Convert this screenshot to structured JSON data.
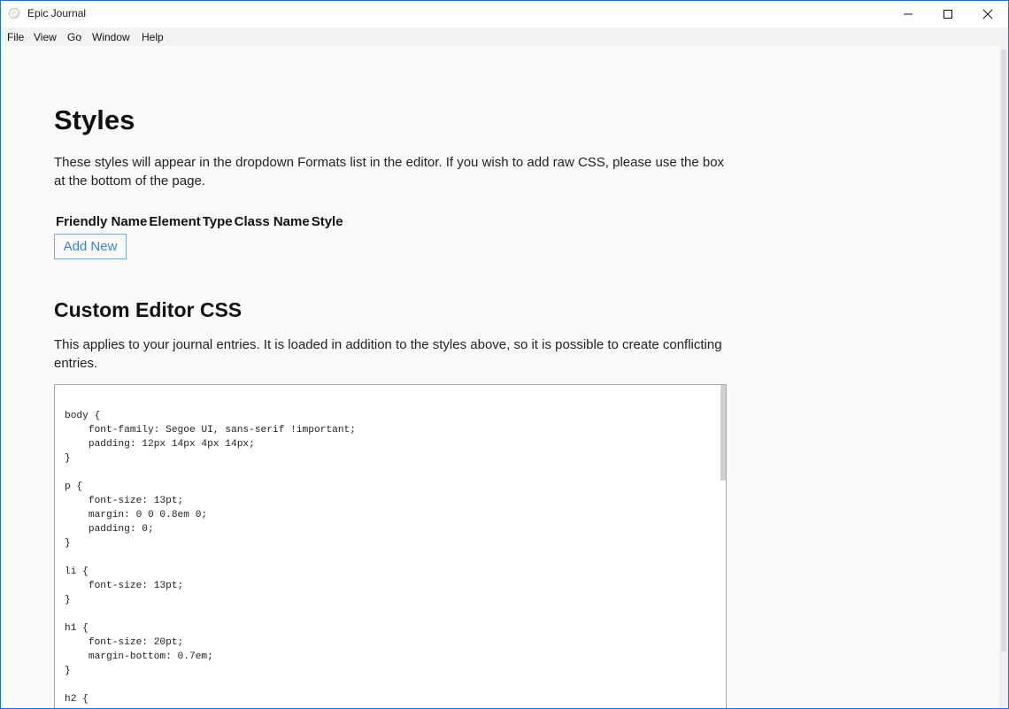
{
  "window": {
    "title": "Epic Journal",
    "icon": "app-icon",
    "controls": {
      "minimize": "–",
      "maximize": "☐",
      "close": "✕"
    }
  },
  "menu": [
    "File",
    "View",
    "Go",
    "Window",
    "Help"
  ],
  "styles_section": {
    "title": "Styles",
    "description": "These styles will appear in the dropdown Formats list in the editor. If you wish to add raw CSS, please use the box at the bottom of the page.",
    "columns": [
      "Friendly Name",
      "Element",
      "Type",
      "Class Name",
      "Style"
    ],
    "add_button": "Add New"
  },
  "css_section": {
    "title": "Custom Editor CSS",
    "description": "This applies to your journal entries. It is loaded in addition to the styles above, so it is possible to create conflicting entries.",
    "css_text": "body {\n    font-family: Segoe UI, sans-serif !important;\n    padding: 12px 14px 4px 14px;\n}\n\np {\n    font-size: 13pt;\n    margin: 0 0 0.8em 0;\n    padding: 0;\n}\n\nli {\n    font-size: 13pt;\n}\n\nh1 {\n    font-size: 20pt;\n    margin-bottom: 0.7em;\n}\n\nh2 {"
  },
  "colors": {
    "accent_border": "#1a73c9",
    "button_text": "#3f82c9"
  }
}
